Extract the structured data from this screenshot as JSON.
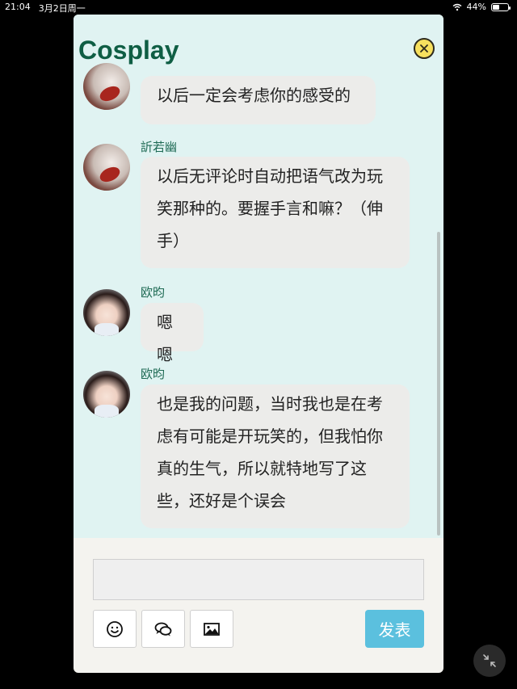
{
  "status_bar": {
    "time": "21:04",
    "date": "3月2日周一",
    "battery": "44%",
    "battery_level": 0.44
  },
  "app": {
    "title": "Cosplay"
  },
  "messages": [
    {
      "name": "",
      "text": "以后一定会考虑你的感受的"
    },
    {
      "name": "訢若幽",
      "lines": [
        "以后无评论时自动把语气改为玩",
        "笑那种的。要握手言和嘛？（伸",
        "手）"
      ]
    },
    {
      "name": "欧昀",
      "text": "嗯嗯"
    },
    {
      "name": "欧昀",
      "lines": [
        "也是我的问题，当时我也是在考",
        "虑有可能是开玩笑的，但我怕你",
        "真的生气，所以就特地写了这",
        "些，还好是个误会"
      ]
    }
  ],
  "composer": {
    "send_label": "发表"
  },
  "icons": {
    "close": "close-icon",
    "emoji": "emoji-icon",
    "comment": "comment-icon",
    "image": "image-icon",
    "collapse": "collapse-icon",
    "wifi": "wifi-icon",
    "battery": "battery-icon"
  }
}
